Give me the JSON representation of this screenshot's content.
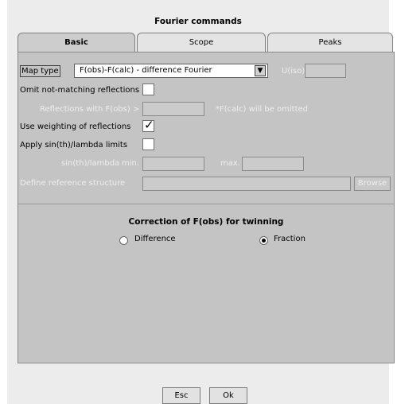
{
  "window": {
    "title": "Fourier commands"
  },
  "tabs": [
    {
      "label": "Basic",
      "active": true
    },
    {
      "label": "Scope",
      "active": false
    },
    {
      "label": "Peaks",
      "active": false
    }
  ],
  "basic": {
    "map_type_label": "Map type",
    "map_type_value": "F(obs)-F(calc) - difference Fourier",
    "uiso_label": "U(iso)",
    "uiso_value": "",
    "omit_label": "Omit not-matching reflections",
    "omit_checked": false,
    "refl_fobs_label": "Reflections with F(obs) >",
    "refl_fobs_value": "",
    "refl_fobs_note": "*F(calc) will be omitted",
    "weighting_label": "Use weighting of reflections",
    "weighting_checked": true,
    "sinth_label": "Apply sin(th)/lambda limits",
    "sinth_checked": false,
    "sinth_lambda_label": "sin(th)/lambda",
    "min_label": "min.",
    "min_value": "",
    "max_label": "max.",
    "max_value": "",
    "ref_struct_label": "Define reference structure",
    "ref_struct_value": "",
    "browse_label": "Browse"
  },
  "twinning": {
    "title": "Correction of F(obs) for twinning",
    "options": [
      {
        "label": "Difference",
        "selected": false
      },
      {
        "label": "Fraction",
        "selected": true
      }
    ]
  },
  "buttons": {
    "esc": "Esc",
    "ok": "Ok"
  },
  "colors": {
    "panel": "#c4c4c4",
    "disabled_text": "#eeeeee"
  }
}
